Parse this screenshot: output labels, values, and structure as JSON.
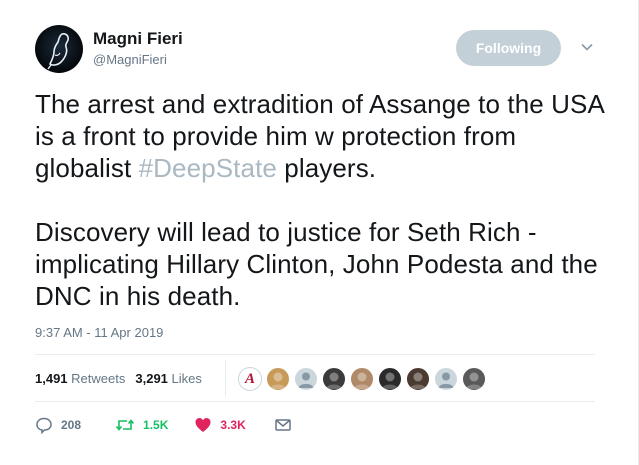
{
  "user": {
    "full_name": "Magni Fieri",
    "handle": "@MagniFieri"
  },
  "follow_button": {
    "label": "Following"
  },
  "tweet": {
    "paragraph1_before": "The arrest and extradition of Assange to the USA is a front to provide him w protection from globalist ",
    "hashtag": "#DeepState",
    "paragraph1_after": " players.",
    "paragraph2": "Discovery will lead to justice for Seth Rich - implicating Hillary Clinton, John Podesta and the DNC in his death.",
    "timestamp": "9:37 AM - 11 Apr 2019"
  },
  "stats": {
    "retweets_count": "1,491",
    "retweets_label": "Retweets",
    "likes_count": "3,291",
    "likes_label": "Likes"
  },
  "likers": [
    {
      "icon": "a-logo-avatar",
      "color": "#ffffff",
      "text": "A"
    },
    {
      "icon": "person-avatar",
      "color": "#c89a5a",
      "text": ""
    },
    {
      "icon": "default-egg-avatar",
      "color": "#ccd6dd",
      "text": ""
    },
    {
      "icon": "person-avatar",
      "color": "#3b3b3b",
      "text": ""
    },
    {
      "icon": "person-avatar",
      "color": "#b08a68",
      "text": ""
    },
    {
      "icon": "group-avatar",
      "color": "#2a2a2a",
      "text": ""
    },
    {
      "icon": "person-avatar",
      "color": "#4a3a30",
      "text": ""
    },
    {
      "icon": "default-egg-avatar",
      "color": "#ccd6dd",
      "text": ""
    },
    {
      "icon": "person-avatar",
      "color": "#5a5a5a",
      "text": ""
    }
  ],
  "actions": {
    "reply_count": "208",
    "retweet_count": "1.5K",
    "like_count": "3.3K"
  },
  "colors": {
    "retweet_green": "#17bf63",
    "like_red": "#e0245e",
    "muted": "#657786",
    "hashtag": "#aab8c2"
  }
}
